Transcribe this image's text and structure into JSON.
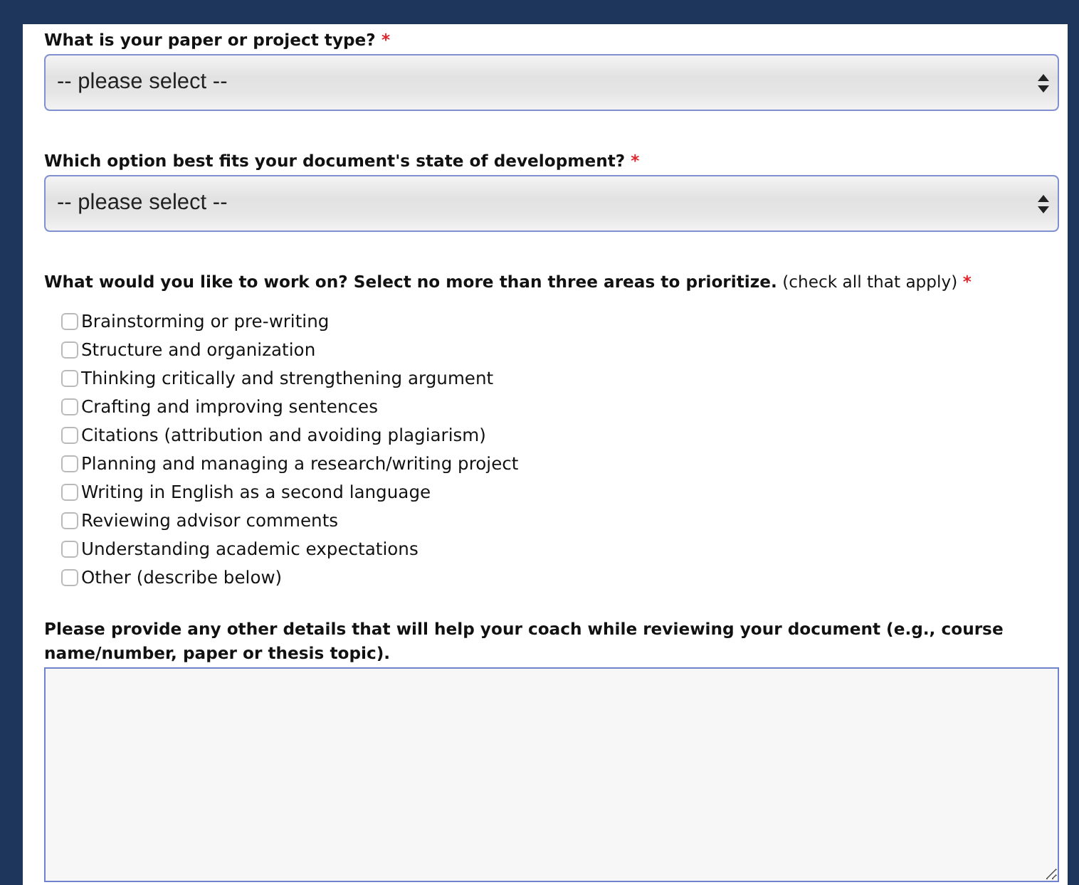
{
  "questions": [
    {
      "kind": "select",
      "label": "What is your paper or project type?",
      "required_mark": "*",
      "value": "-- please select --"
    },
    {
      "kind": "select",
      "label": "Which option best fits your document's state of development?",
      "required_mark": "*",
      "value": "-- please select --"
    },
    {
      "kind": "checkboxes",
      "label": "**What would you like to work on? Select no more than three areas to prioritize.** (check all that apply)",
      "required_mark": "*",
      "options": [
        {
          "label": "Brainstorming or pre-writing",
          "checked": false
        },
        {
          "label": "Structure and organization",
          "checked": false
        },
        {
          "label": "Thinking critically and strengthening argument",
          "checked": false
        },
        {
          "label": "Crafting and improving sentences",
          "checked": false
        },
        {
          "label": "Citations (attribution and avoiding plagiarism)",
          "checked": false
        },
        {
          "label": "Planning and managing a research/writing project",
          "checked": false
        },
        {
          "label": "Writing in English as a second language",
          "checked": false
        },
        {
          "label": "Reviewing advisor comments",
          "checked": false
        },
        {
          "label": "Understanding academic expectations",
          "checked": false
        },
        {
          "label": "Other (describe below)",
          "checked": false
        }
      ]
    },
    {
      "kind": "textarea",
      "label": "Please provide any other details that will help your coach while reviewing your document (e.g., course name/number, paper or thesis topic)."
    }
  ]
}
